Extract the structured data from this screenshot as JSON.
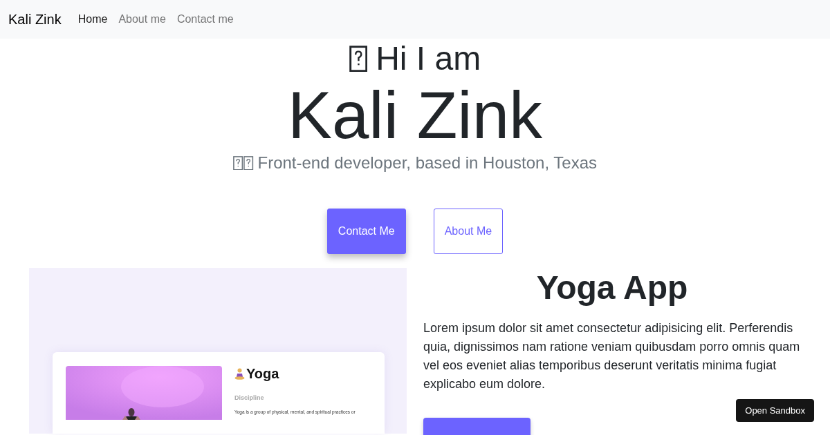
{
  "navbar": {
    "brand": "Kali Zink",
    "links": [
      {
        "label": "Home",
        "selected": true
      },
      {
        "label": "About me",
        "selected": false
      },
      {
        "label": "Contact me",
        "selected": false
      }
    ]
  },
  "hero": {
    "greeting": "Hi I am",
    "name": "Kali Zink",
    "tagline": "Front-end developer, based in Houston, Texas"
  },
  "buttons": [
    {
      "label": "Contact Me",
      "kind": "primary"
    },
    {
      "label": "About Me",
      "kind": "outline"
    }
  ],
  "project": {
    "title": "Yoga App",
    "description": "Lorem ipsum dolor sit amet consectetur adipisicing elit. Perferendis quia, dignissimos nam ratione veniam quibusdam porro omnis quam vel eos eveniet alias temporibus deserunt veritatis minima fugiat explicabo eum dolore.",
    "preview": {
      "title": "Yoga",
      "label": "Discipline",
      "text": "Yoga is a group of physical, mental, and spiritual practices or"
    }
  },
  "sandbox_button": "Open Sandbox"
}
